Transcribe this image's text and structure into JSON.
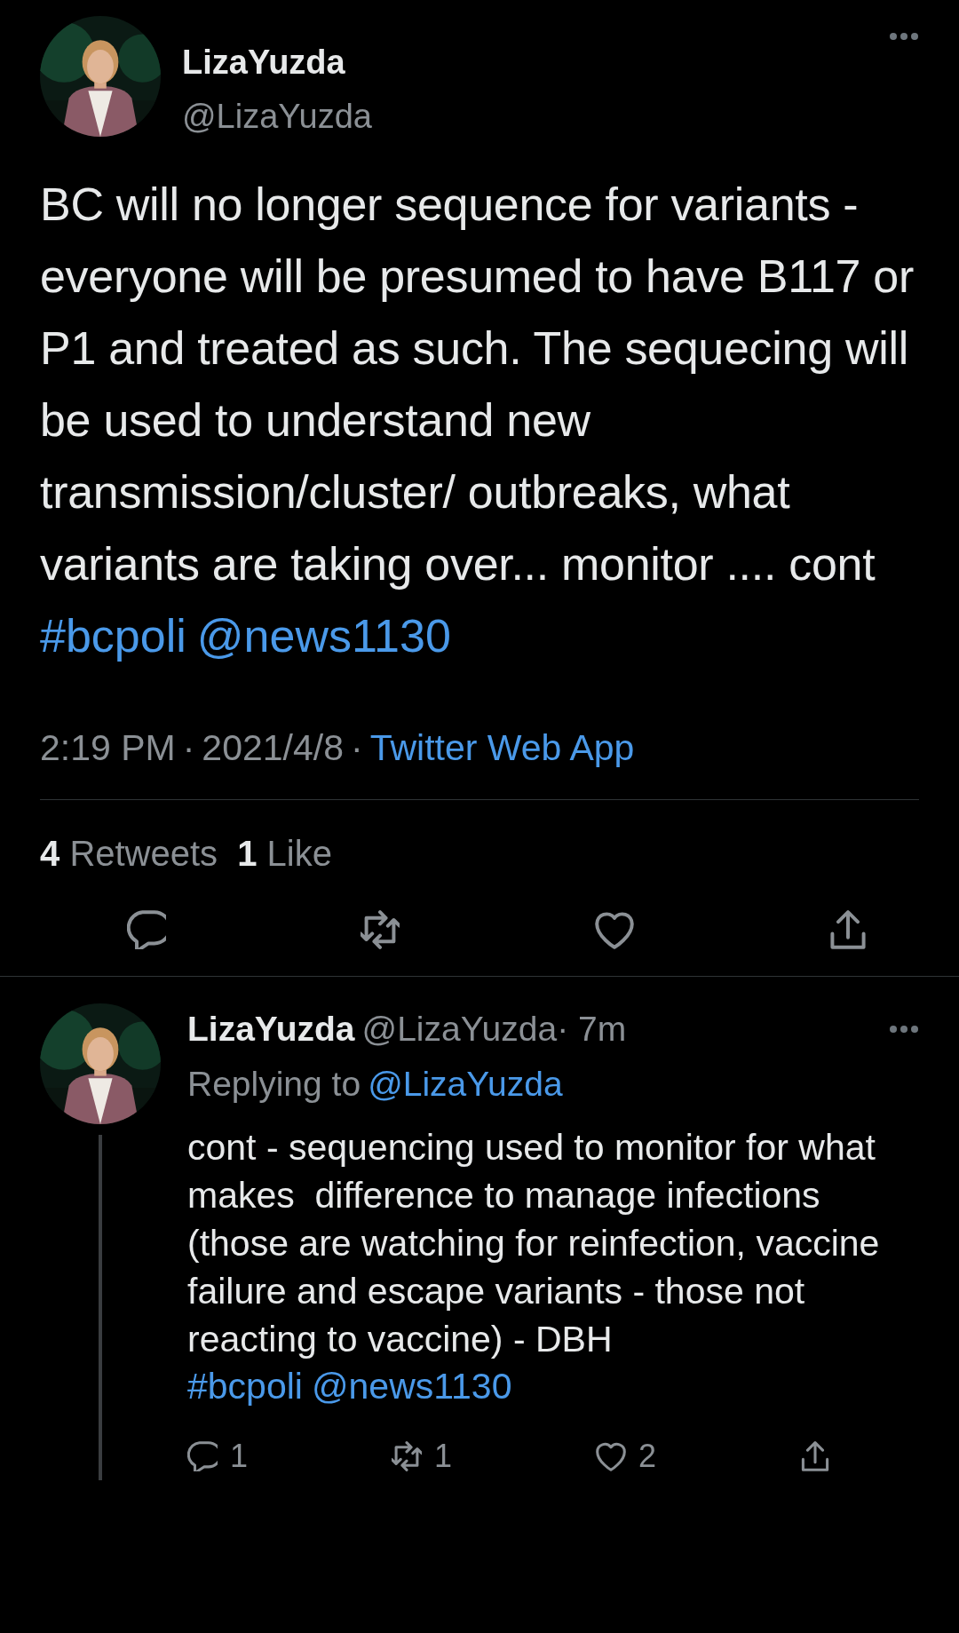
{
  "tweet": {
    "name": "LizaYuzda",
    "handle": "@LizaYuzda",
    "text": "BC will no longer sequence for variants - everyone will be presumed to have B117 or P1 and treated as such. The sequecing will be used to understand new transmission/cluster/ outbreaks, what variants are taking over... monitor .... cont",
    "tags": [
      "#bcpoli",
      "@news1130"
    ],
    "time": "2:19 PM",
    "separator": "·",
    "date": "2021/4/8",
    "source": "Twitter Web App",
    "stats": [
      {
        "count": "4",
        "label": "Retweets"
      },
      {
        "count": "1",
        "label": "Like"
      }
    ]
  },
  "reply": {
    "name": "LizaYuzda",
    "handle": "@LizaYuzda",
    "age": "· 7m",
    "replying_label": "Replying to",
    "replying_to": "@LizaYuzda",
    "text": "cont - sequencing used to monitor for what makes  difference to manage infections (those are watching for reinfection, vaccine failure and escape variants - those not reacting to vaccine) - DBH",
    "tags": [
      "#bcpoli",
      "@news1130"
    ],
    "actions": [
      {
        "kind": "reply",
        "count": "1"
      },
      {
        "kind": "retweet",
        "count": "1"
      },
      {
        "kind": "like",
        "count": "2"
      },
      {
        "kind": "share"
      }
    ]
  }
}
